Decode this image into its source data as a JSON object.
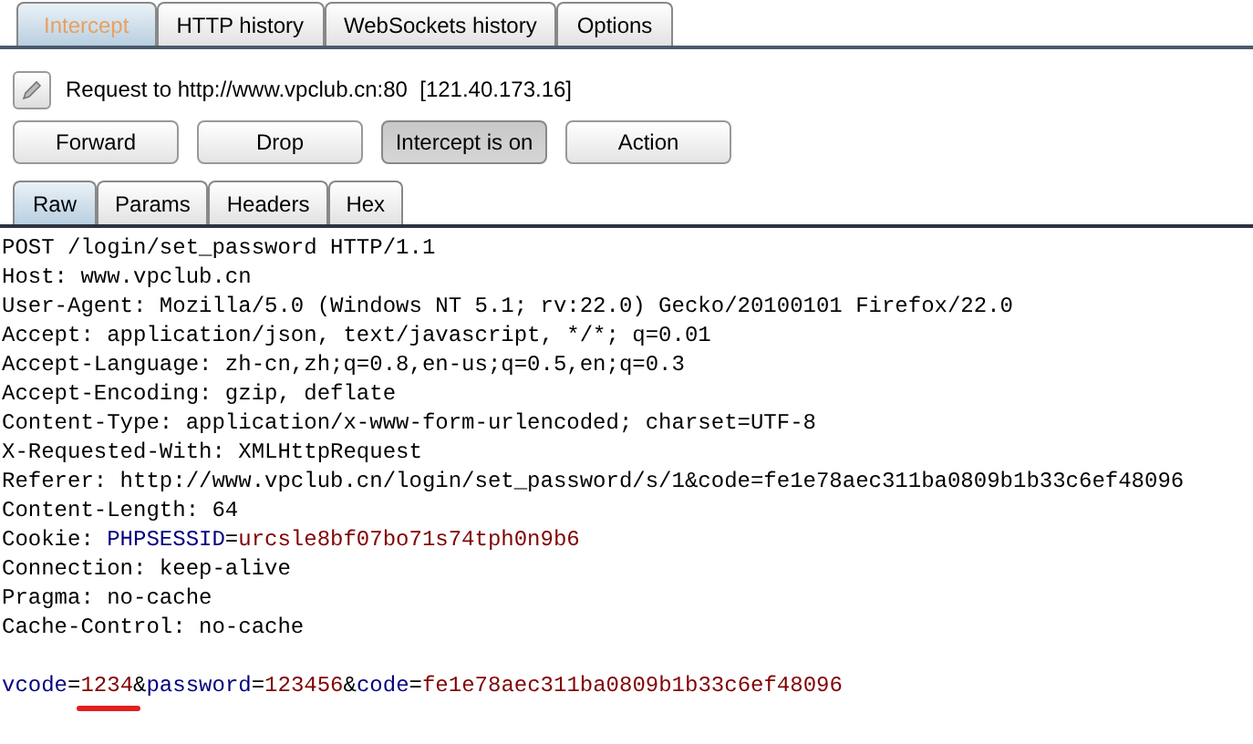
{
  "tabs": [
    {
      "label": "Intercept",
      "selected": true
    },
    {
      "label": "HTTP history",
      "selected": false
    },
    {
      "label": "WebSockets history",
      "selected": false
    },
    {
      "label": "Options",
      "selected": false
    }
  ],
  "request_info": {
    "text": "Request to http://www.vpclub.cn:80  [121.40.173.16]"
  },
  "buttons": [
    {
      "label": "Forward",
      "pressed": false
    },
    {
      "label": "Drop",
      "pressed": false
    },
    {
      "label": "Intercept is on",
      "pressed": true
    },
    {
      "label": "Action",
      "pressed": false
    }
  ],
  "view_tabs": [
    {
      "label": "Raw",
      "selected": true
    },
    {
      "label": "Params",
      "selected": false
    },
    {
      "label": "Headers",
      "selected": false
    },
    {
      "label": "Hex",
      "selected": false
    }
  ],
  "body": [
    {
      "kind": "text",
      "segments": [
        {
          "text": "POST /login/set_password HTTP/1.1",
          "kind": "plain"
        }
      ]
    },
    {
      "kind": "text",
      "segments": [
        {
          "text": "Host: www.vpclub.cn",
          "kind": "plain"
        }
      ]
    },
    {
      "kind": "text",
      "segments": [
        {
          "text": "User-Agent: Mozilla/5.0 (Windows NT 5.1; rv:22.0) Gecko/20100101 Firefox/22.0",
          "kind": "plain"
        }
      ]
    },
    {
      "kind": "text",
      "segments": [
        {
          "text": "Accept: application/json, text/javascript, */*; q=0.01",
          "kind": "plain"
        }
      ]
    },
    {
      "kind": "text",
      "segments": [
        {
          "text": "Accept-Language: zh-cn,zh;q=0.8,en-us;q=0.5,en;q=0.3",
          "kind": "plain"
        }
      ]
    },
    {
      "kind": "text",
      "segments": [
        {
          "text": "Accept-Encoding: gzip, deflate",
          "kind": "plain"
        }
      ]
    },
    {
      "kind": "text",
      "segments": [
        {
          "text": "Content-Type: application/x-www-form-urlencoded; charset=UTF-8",
          "kind": "plain"
        }
      ]
    },
    {
      "kind": "text",
      "segments": [
        {
          "text": "X-Requested-With: XMLHttpRequest",
          "kind": "plain"
        }
      ]
    },
    {
      "kind": "text",
      "segments": [
        {
          "text": "Referer: http://www.vpclub.cn/login/set_password/s/1&code=fe1e78aec311ba0809b1b33c6ef48096",
          "kind": "plain"
        }
      ]
    },
    {
      "kind": "text",
      "segments": [
        {
          "text": "Content-Length: 64",
          "kind": "plain"
        }
      ]
    },
    {
      "kind": "text",
      "segments": [
        {
          "text": "Cookie: ",
          "kind": "plain"
        },
        {
          "text": "PHPSESSID",
          "kind": "name"
        },
        {
          "text": "=",
          "kind": "plain"
        },
        {
          "text": "urcsle8bf07bo71s74tph0n9b6",
          "kind": "value"
        }
      ]
    },
    {
      "kind": "text",
      "segments": [
        {
          "text": "Connection: keep-alive",
          "kind": "plain"
        }
      ]
    },
    {
      "kind": "text",
      "segments": [
        {
          "text": "Pragma: no-cache",
          "kind": "plain"
        }
      ]
    },
    {
      "kind": "text",
      "segments": [
        {
          "text": "Cache-Control: no-cache",
          "kind": "plain"
        }
      ]
    },
    {
      "kind": "blank"
    },
    {
      "kind": "text",
      "segments": [
        {
          "text": "vcode",
          "kind": "name"
        },
        {
          "text": "=",
          "kind": "plain"
        },
        {
          "text": "1234",
          "kind": "value",
          "underlined": true
        },
        {
          "text": "&",
          "kind": "plain"
        },
        {
          "text": "password",
          "kind": "name"
        },
        {
          "text": "=",
          "kind": "plain"
        },
        {
          "text": "123456",
          "kind": "value"
        },
        {
          "text": "&",
          "kind": "plain"
        },
        {
          "text": "code",
          "kind": "name"
        },
        {
          "text": "=",
          "kind": "plain"
        },
        {
          "text": "fe1e78aec311ba0809b1b33c6ef48096",
          "kind": "value"
        }
      ]
    }
  ]
}
